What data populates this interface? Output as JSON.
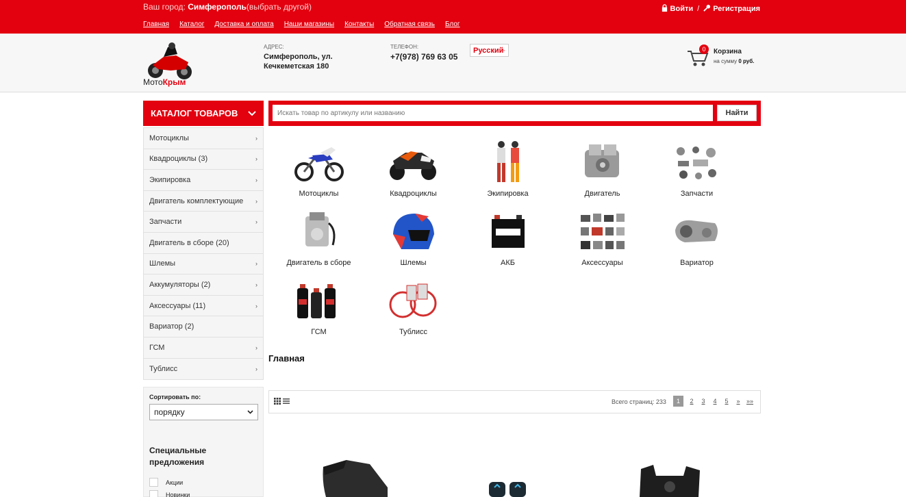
{
  "topbar": {
    "city_label": "Ваш город:",
    "city_name": "Симферополь",
    "city_change": "(выбрать другой)",
    "login": "Войти",
    "separator": "/",
    "register": "Регистрация",
    "nav": [
      "Главная",
      "Каталог",
      "Доставка и оплата",
      "Наши магазины",
      "Контакты",
      "Обратная связь",
      "Блог"
    ]
  },
  "header": {
    "logo_text_1": "Мото",
    "logo_text_2": "Крым",
    "address_label": "АДРЕС:",
    "address": "Симферополь, ул. Кечкеметская 180",
    "phone_label": "ТЕЛЕФОН:",
    "phone": "+7(978) 769 63 05",
    "language": "Русский",
    "cart_count": "0",
    "cart_title": "Корзина",
    "cart_sum_prefix": "на сумму",
    "cart_sum": "0 руб."
  },
  "catalog": {
    "title": "КАТАЛОГ ТОВАРОВ",
    "items": [
      {
        "label": "Мотоциклы",
        "arrow": "›"
      },
      {
        "label": "Квадроциклы (3)",
        "arrow": "›"
      },
      {
        "label": "Экипировка",
        "arrow": "›"
      },
      {
        "label": "Двигатель комплектующие",
        "arrow": "›"
      },
      {
        "label": "Запчасти",
        "arrow": "›"
      },
      {
        "label": "Двигатель в сборе (20)",
        "arrow": ""
      },
      {
        "label": "Шлемы",
        "arrow": "›"
      },
      {
        "label": "Аккумуляторы (2)",
        "arrow": "›"
      },
      {
        "label": "Аксессуары (11)",
        "arrow": "›"
      },
      {
        "label": "Вариатор (2)",
        "arrow": ""
      },
      {
        "label": "ГСМ",
        "arrow": "›"
      },
      {
        "label": "Тублисс",
        "arrow": "›"
      }
    ]
  },
  "search": {
    "placeholder": "Искать товар по артикулу или названию",
    "button": "Найти"
  },
  "categories": [
    {
      "label": "Мотоциклы",
      "icon": "motocross-bike-image"
    },
    {
      "label": "Квадроциклы",
      "icon": "atv-image"
    },
    {
      "label": "Экипировка",
      "icon": "riding-gear-image"
    },
    {
      "label": "Двигатель",
      "icon": "engine-image"
    },
    {
      "label": "Запчасти",
      "icon": "spare-parts-image"
    },
    {
      "label": "Двигатель в сборе",
      "icon": "engine-assembly-image"
    },
    {
      "label": "Шлемы",
      "icon": "helmet-image"
    },
    {
      "label": "АКБ",
      "icon": "battery-image"
    },
    {
      "label": "Аксессуары",
      "icon": "accessories-image"
    },
    {
      "label": "Вариатор",
      "icon": "variator-image"
    },
    {
      "label": "ГСМ",
      "icon": "oil-bottles-image"
    },
    {
      "label": "Тублисс",
      "icon": "tubliss-image"
    }
  ],
  "main": {
    "page_title": "Главная"
  },
  "sort": {
    "label": "Сортировать по:",
    "selected": "порядку"
  },
  "special": {
    "title": "Специальные предложения",
    "options": [
      "Акции",
      "Новинки"
    ]
  },
  "pagination": {
    "total_label": "Всего страниц: 233",
    "pages": [
      "1",
      "2",
      "3",
      "4",
      "5",
      "»",
      "»»"
    ],
    "current": "1"
  },
  "colors": {
    "accent": "#e3000f",
    "sidebar_bg": "#f5f5f5"
  }
}
